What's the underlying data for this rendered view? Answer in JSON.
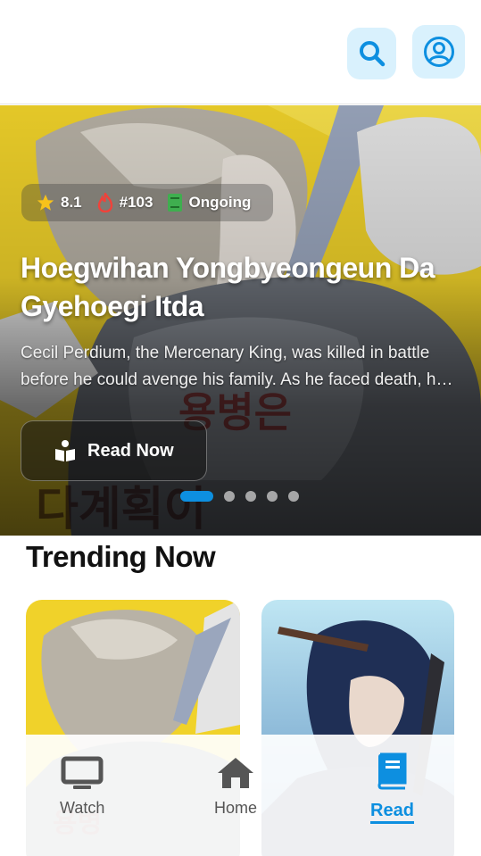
{
  "header": {
    "search_icon": "search-icon",
    "profile_icon": "user-circle-icon",
    "accent": "#0d8fe0",
    "button_bg": "#d9f1fd"
  },
  "hero": {
    "rating": "8.1",
    "rank": "#103",
    "status": "Ongoing",
    "title": "Hoegwihan Yongbyeongeun Da Gyehoegi Itda",
    "description": "Cecil Perdium, the Mercenary King, was killed in battle before he could avenge his family. As he faced death, he regretted not having ended it with his own hands.",
    "read_button": "Read Now",
    "art_text": "회귀한 용병은 다 계획이 있다",
    "slide_count": 5,
    "active_slide": 1
  },
  "trending": {
    "title": "Trending Now"
  },
  "nav": {
    "items": [
      {
        "label": "Watch",
        "icon": "monitor-icon"
      },
      {
        "label": "Home",
        "icon": "home-icon"
      },
      {
        "label": "Read",
        "icon": "book-icon"
      }
    ],
    "active": "Read"
  }
}
